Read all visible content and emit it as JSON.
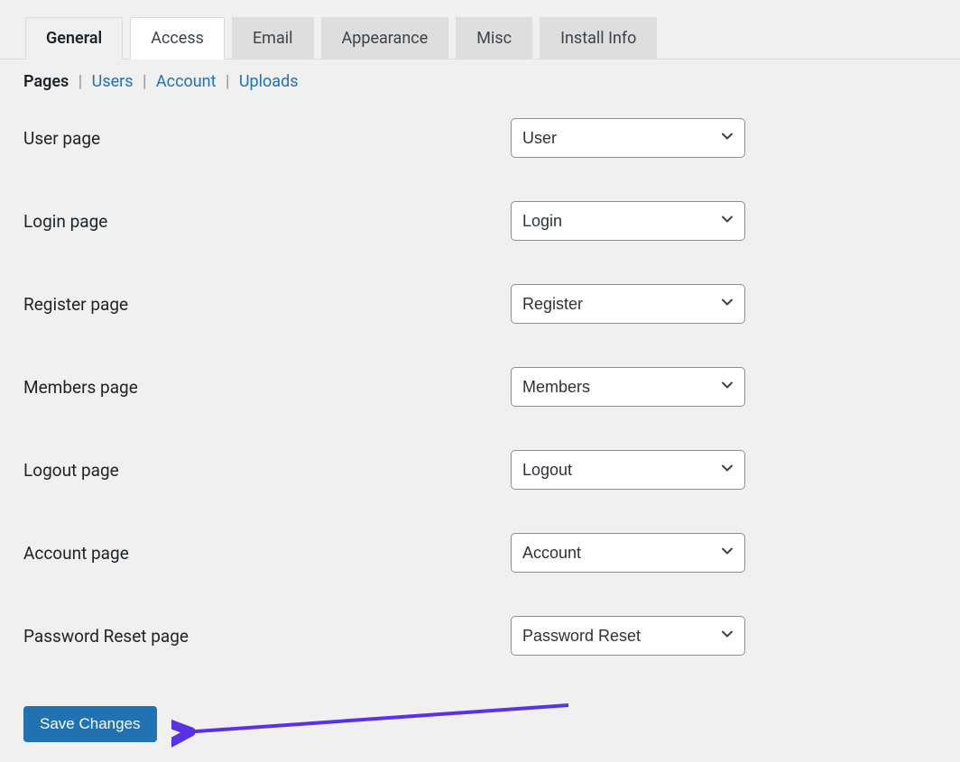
{
  "tabs": [
    {
      "label": "General",
      "active": true
    },
    {
      "label": "Access"
    },
    {
      "label": "Email"
    },
    {
      "label": "Appearance"
    },
    {
      "label": "Misc"
    },
    {
      "label": "Install Info"
    }
  ],
  "subnav": [
    {
      "label": "Pages",
      "current": true
    },
    {
      "label": "Users"
    },
    {
      "label": "Account"
    },
    {
      "label": "Uploads"
    }
  ],
  "fields": [
    {
      "label": "User page",
      "value": "User"
    },
    {
      "label": "Login page",
      "value": "Login"
    },
    {
      "label": "Register page",
      "value": "Register"
    },
    {
      "label": "Members page",
      "value": "Members"
    },
    {
      "label": "Logout page",
      "value": "Logout"
    },
    {
      "label": "Account page",
      "value": "Account"
    },
    {
      "label": "Password Reset page",
      "value": "Password Reset"
    }
  ],
  "save_label": "Save Changes",
  "annotation_arrow_color": "#5a32e6"
}
